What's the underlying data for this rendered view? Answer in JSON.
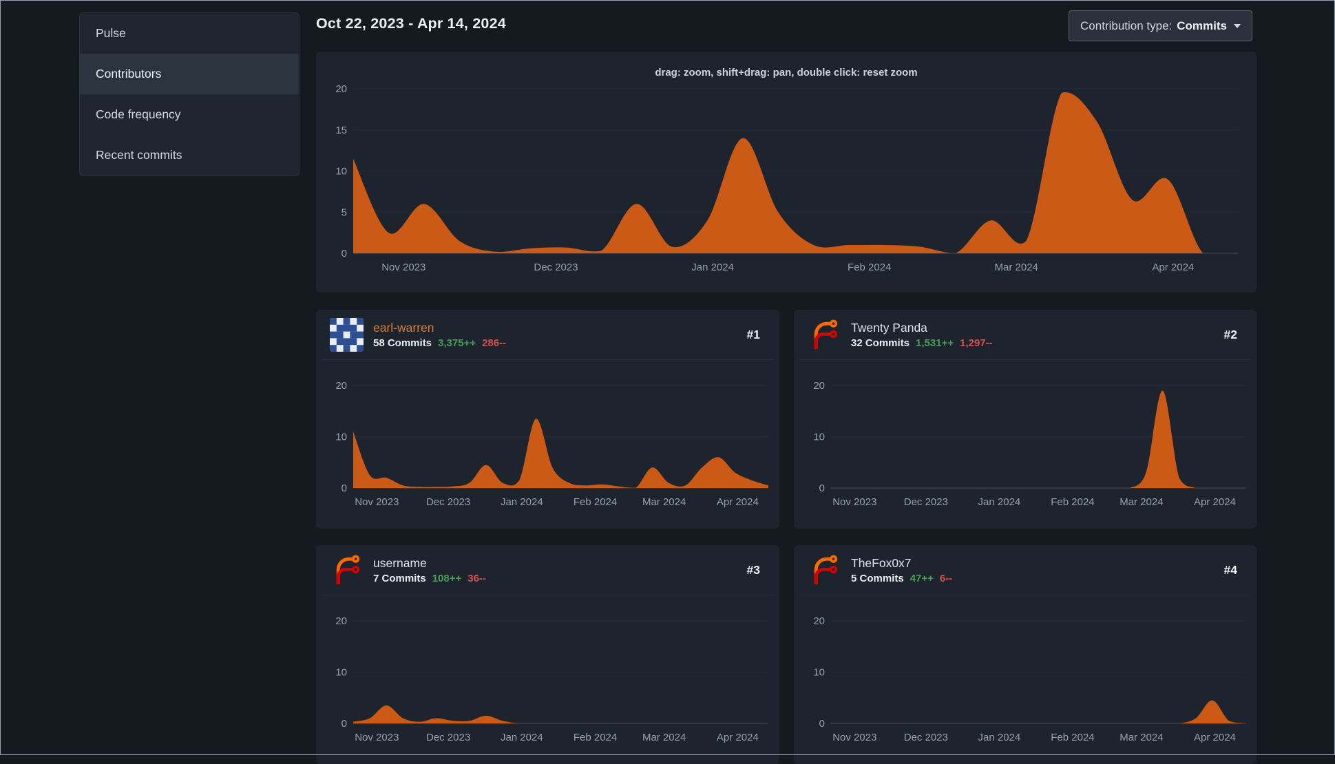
{
  "sidebar": {
    "items": [
      {
        "label": "Pulse"
      },
      {
        "label": "Contributors"
      },
      {
        "label": "Code frequency"
      },
      {
        "label": "Recent commits"
      }
    ],
    "active_index": 1
  },
  "header": {
    "date_range": "Oct 22, 2023 - Apr 14, 2024",
    "contribution_type_label": "Contribution type:",
    "contribution_type_value": "Commits"
  },
  "colors": {
    "area_fill": "#ca5a16",
    "additions_green": "#4b9e58",
    "deletions_red": "#d45252",
    "link_orange": "#d87c3a"
  },
  "contributors": [
    {
      "name": "earl-warren",
      "rank": "#1",
      "commits": "58 Commits",
      "additions": "3,375++",
      "deletions": "286--",
      "avatar": "identicon",
      "name_color": "#d87c3a",
      "linked": true
    },
    {
      "name": "Twenty Panda",
      "rank": "#2",
      "commits": "32 Commits",
      "additions": "1,531++",
      "deletions": "1,297--",
      "avatar": "forgejo",
      "name_color": "#dde4ec",
      "linked": false
    },
    {
      "name": "username",
      "rank": "#3",
      "commits": "7 Commits",
      "additions": "108++",
      "deletions": "36--",
      "avatar": "forgejo",
      "name_color": "#dde4ec",
      "linked": false
    },
    {
      "name": "TheFox0x7",
      "rank": "#4",
      "commits": "5 Commits",
      "additions": "47++",
      "deletions": "6--",
      "avatar": "forgejo",
      "name_color": "#dde4ec",
      "linked": false
    }
  ],
  "chart_data": [
    {
      "id": "overall-commits",
      "type": "area",
      "title": "drag: zoom, shift+drag: pan, double click: reset zoom",
      "x_labels": [
        "Nov 2023",
        "Dec 2023",
        "Jan 2024",
        "Feb 2024",
        "Mar 2024",
        "Apr 2024"
      ],
      "x_label_fracs": [
        0.057,
        0.229,
        0.406,
        0.583,
        0.749,
        0.926
      ],
      "y_ticks": [
        0,
        5,
        10,
        15,
        20
      ],
      "ylim": [
        0,
        20
      ],
      "x_unit": "weeks from Oct 22 2023 to Apr 14 2024",
      "values": [
        11.5,
        2.5,
        6,
        1.5,
        0.2,
        0.6,
        0.7,
        0.3,
        6,
        0.8,
        4,
        14,
        5,
        1,
        1,
        1,
        0.8,
        0,
        4,
        1.5,
        19.5,
        16,
        6.5,
        9,
        0,
        0
      ],
      "fill_color": "#ca5a16",
      "grid": true,
      "legend": "none"
    },
    {
      "id": "earl-warren-commits",
      "type": "area",
      "title": "earl-warren weekly commits",
      "x_labels": [
        "Nov 2023",
        "Dec 2023",
        "Jan 2024",
        "Feb 2024",
        "Mar 2024",
        "Apr 2024"
      ],
      "x_label_fracs": [
        0.057,
        0.229,
        0.406,
        0.583,
        0.749,
        0.926
      ],
      "y_ticks": [
        0,
        10,
        20
      ],
      "ylim": [
        0,
        20
      ],
      "values": [
        11,
        2.5,
        2,
        0.5,
        0.2,
        0.2,
        0.3,
        1,
        4.5,
        1,
        1.5,
        13.5,
        4,
        1,
        0.5,
        0.7,
        0.3,
        0,
        4,
        1,
        0.5,
        4,
        6,
        3,
        1.5,
        0.5
      ],
      "fill_color": "#ca5a16",
      "grid": true,
      "legend": "none"
    },
    {
      "id": "twenty-panda-commits",
      "type": "area",
      "title": "Twenty Panda weekly commits",
      "x_labels": [
        "Nov 2023",
        "Dec 2023",
        "Jan 2024",
        "Feb 2024",
        "Mar 2024",
        "Apr 2024"
      ],
      "x_label_fracs": [
        0.057,
        0.229,
        0.406,
        0.583,
        0.749,
        0.926
      ],
      "y_ticks": [
        0,
        10,
        20
      ],
      "ylim": [
        0,
        20
      ],
      "values": [
        0,
        0,
        0,
        0,
        0,
        0,
        0,
        0,
        0,
        0,
        0,
        0,
        0,
        0,
        0,
        0,
        0,
        0,
        0,
        3,
        19,
        2,
        0,
        0,
        0,
        0
      ],
      "fill_color": "#ca5a16",
      "grid": true,
      "legend": "none"
    },
    {
      "id": "username-commits",
      "type": "area",
      "title": "username weekly commits",
      "x_labels": [
        "Nov 2023",
        "Dec 2023",
        "Jan 2024",
        "Feb 2024",
        "Mar 2024",
        "Apr 2024"
      ],
      "x_label_fracs": [
        0.057,
        0.229,
        0.406,
        0.583,
        0.749,
        0.926
      ],
      "y_ticks": [
        0,
        10,
        20
      ],
      "ylim": [
        0,
        20
      ],
      "values": [
        0.3,
        1,
        3.5,
        1,
        0.3,
        1,
        0.5,
        0.5,
        1.5,
        0.5,
        0,
        0,
        0,
        0,
        0,
        0,
        0,
        0,
        0,
        0,
        0,
        0,
        0,
        0,
        0,
        0
      ],
      "fill_color": "#ca5a16",
      "grid": true,
      "legend": "none"
    },
    {
      "id": "thefox0x7-commits",
      "type": "area",
      "title": "TheFox0x7 weekly commits",
      "x_labels": [
        "Nov 2023",
        "Dec 2023",
        "Jan 2024",
        "Feb 2024",
        "Mar 2024",
        "Apr 2024"
      ],
      "x_label_fracs": [
        0.057,
        0.229,
        0.406,
        0.583,
        0.749,
        0.926
      ],
      "y_ticks": [
        0,
        10,
        20
      ],
      "ylim": [
        0,
        20
      ],
      "values": [
        0,
        0,
        0,
        0,
        0,
        0,
        0,
        0,
        0,
        0,
        0,
        0,
        0,
        0,
        0,
        0,
        0,
        0,
        0,
        0,
        0,
        0,
        1,
        4.5,
        0.5,
        0
      ],
      "fill_color": "#ca5a16",
      "grid": true,
      "legend": "none"
    }
  ]
}
